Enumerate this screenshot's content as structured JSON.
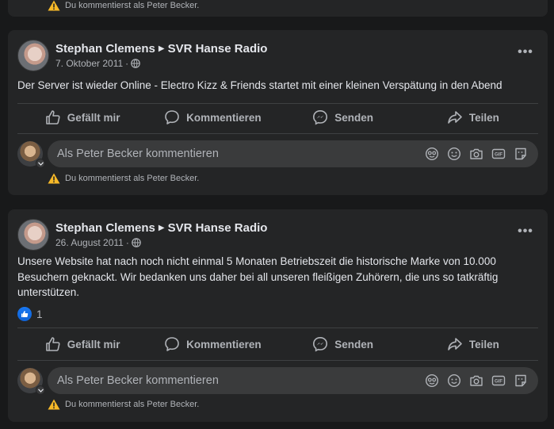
{
  "top_card": {
    "warning": "Du kommentierst als Peter Becker."
  },
  "posts": [
    {
      "author": "Stephan Clemens",
      "page": "SVR Hanse Radio",
      "date": "7. Oktober 2011",
      "separator": "·",
      "text": "Der Server ist wieder Online - Electro Kizz & Friends startet mit einer kleinen Verspätung in den Abend",
      "actions": {
        "like": "Gefällt mir",
        "comment": "Kommentieren",
        "send": "Senden",
        "share": "Teilen"
      },
      "comment_placeholder": "Als Peter Becker kommentieren",
      "warning": "Du kommentierst als Peter Becker."
    },
    {
      "author": "Stephan Clemens",
      "page": "SVR Hanse Radio",
      "date": "26. August 2011",
      "separator": "·",
      "text": "Unsere Website hat nach noch nicht einmal 5 Monaten Betriebszeit die historische Marke von 10.000 Besuchern geknackt. Wir bedanken uns daher bei all unseren fleißigen Zuhörern, die uns so tatkräftig unterstützen.",
      "reaction_count": "1",
      "actions": {
        "like": "Gefällt mir",
        "comment": "Kommentieren",
        "send": "Senden",
        "share": "Teilen"
      },
      "comment_placeholder": "Als Peter Becker kommentieren",
      "warning": "Du kommentierst als Peter Becker."
    }
  ],
  "icons": {
    "more": "more-options-icon",
    "globe": "globe-icon",
    "like": "thumbs-up-icon",
    "comment": "comment-bubble-icon",
    "send": "messenger-icon",
    "share": "share-arrow-icon",
    "warning": "warning-triangle-icon",
    "avatar_sticker": "avatar-sticker-icon",
    "emoji": "emoji-icon",
    "camera": "camera-icon",
    "gif": "gif-icon",
    "sticker": "sticker-icon"
  },
  "colors": {
    "background": "#18191a",
    "card": "#242526",
    "input": "#3a3b3c",
    "text": "#e4e6eb",
    "secondary": "#b0b3b8",
    "warning": "#f7b928",
    "like_blue": "#1877f2"
  }
}
